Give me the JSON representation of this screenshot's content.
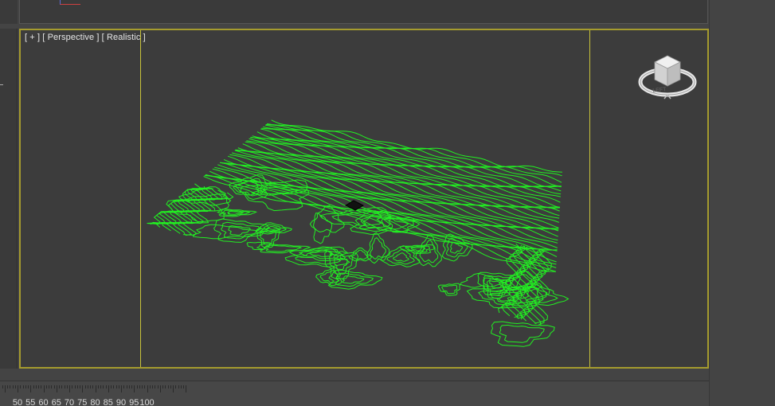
{
  "viewport": {
    "label": "[ + ] [ Perspective ] [ Realistic ]"
  },
  "viewcube": {
    "face_label": "LEFT",
    "icon": "viewcube-icon"
  },
  "timeline": {
    "start": 50,
    "end": 100,
    "labels": [
      "50",
      "55",
      "60",
      "65",
      "70",
      "75",
      "80",
      "85",
      "90",
      "95",
      "100"
    ]
  },
  "colors": {
    "contour": "#22f022",
    "viewport_border": "#a59b2e",
    "safe_frame": "#c8c23a",
    "viewport_bg": "#3c3c3c"
  }
}
